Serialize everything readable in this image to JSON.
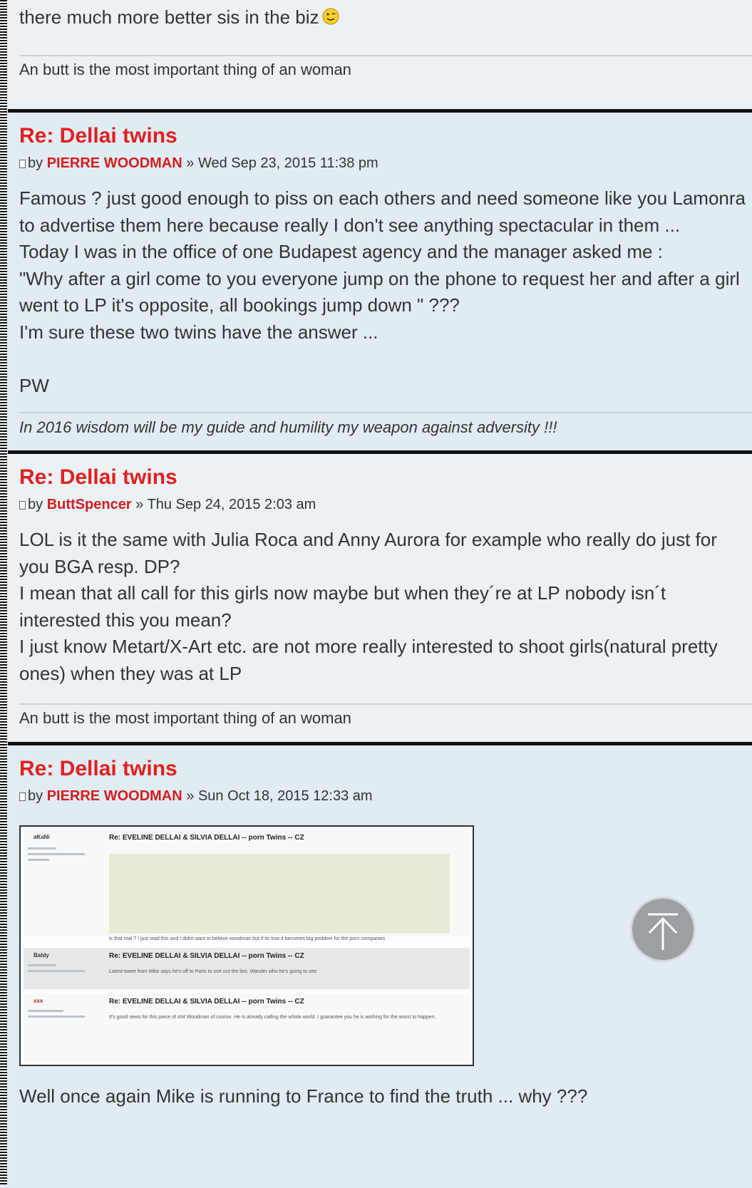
{
  "post0": {
    "body_line": "there much more better sis in the biz",
    "signature": "An butt is the most important thing of an woman"
  },
  "post1": {
    "title": "Re: Dellai twins",
    "by": "by",
    "author": "PIERRE WOODMAN",
    "sep": "»",
    "date": "Wed Sep 23, 2015 11:38 pm",
    "lines": [
      "Famous ? just good enough to piss on each others and need someone like you Lamonra",
      "to advertise them here because really I don't see anything spectacular in them ...",
      "Today I was in the office of one Budapest agency and the manager asked me :",
      "\"Why after a girl come to you everyone jump on the phone to request her and after a girl",
      "went to LP it's opposite, all bookings jump down \" ???",
      "I'm sure these two twins have the answer ...",
      "",
      "PW"
    ],
    "signature": "In 2016 wisdom will be my guide and humility my weapon against adversity !!!"
  },
  "post2": {
    "title": "Re: Dellai twins",
    "by": "by",
    "author": "ButtSpencer",
    "sep": "»",
    "date": "Thu Sep 24, 2015 2:03 am",
    "lines": [
      "LOL is it the same with Julia Roca and Anny Aurora for example who really do just for",
      "you BGA resp. DP?",
      "I mean that all call for this girls now maybe but when they´re at LP nobody isn´t",
      "interested this you mean?",
      "I just know Metart/X-Art etc. are not more really interested to shoot girls(natural pretty",
      "ones) when they was at LP"
    ],
    "signature": "An butt is the most important thing of an woman"
  },
  "post3": {
    "title": "Re: Dellai twins",
    "by": "by",
    "author": "PIERRE WOODMAN",
    "sep": "»",
    "date": "Sun Oct 18, 2015 12:33 am",
    "screenshot": {
      "rows": [
        {
          "author": "aKaNi",
          "title": "Re: EVELINE DELLAI & SILVIA DELLAI -- porn Twins -- CZ",
          "text": "is that real ? I just read this and I didnt want to believe woodman but if its true it becomes big problem for the porn companies"
        },
        {
          "author": "Baldy",
          "title": "Re: EVELINE DELLAI & SILVIA DELLAI -- porn Twins -- CZ",
          "text": "Latest tweet from Mike says he's off to Paris to sort out the lies. Wander who he's going to see"
        },
        {
          "author": "xxx",
          "title": "Re: EVELINE DELLAI & SILVIA DELLAI -- porn Twins -- CZ",
          "text": "It's good news for this piece of shit Woodman of course. He is already calling the whole world. I guarantee you he is wishing for the worst to happen."
        }
      ]
    },
    "body_line": "Well once again Mike is running to France to find the truth ... why ???"
  },
  "colors": {
    "title": "#e02020",
    "author": "#d31d1d",
    "post_bg": "#ecf1f5",
    "post_bg_alt": "#e1ebf2",
    "divider": "#111111"
  },
  "icons": {
    "post_icon": "post-icon",
    "smiley": "wink-smiley-icon",
    "scroll_top": "arrow-up-icon"
  }
}
